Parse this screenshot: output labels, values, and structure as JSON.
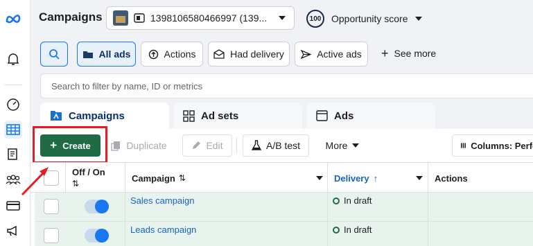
{
  "header": {
    "title": "Campaigns",
    "account_label": "1398106580466997 (139...",
    "opportunity_score": "100",
    "opportunity_label": "Opportunity score"
  },
  "toolbar": {
    "all_ads": "All ads",
    "actions": "Actions",
    "had_delivery": "Had delivery",
    "active_ads": "Active ads",
    "see_more": "See more"
  },
  "search": {
    "placeholder": "Search to filter by name, ID or metrics"
  },
  "tabs": [
    {
      "label": "Campaigns"
    },
    {
      "label": "Ad sets"
    },
    {
      "label": "Ads"
    }
  ],
  "actions": {
    "create": "Create",
    "duplicate": "Duplicate",
    "edit": "Edit",
    "ab_test": "A/B test",
    "more": "More",
    "columns": "Columns: Perfo"
  },
  "table": {
    "columns": {
      "off_on": "Off / On",
      "campaign": "Campaign",
      "delivery": "Delivery",
      "actions": "Actions"
    },
    "rows": [
      {
        "name": "Sales campaign",
        "delivery": "In draft"
      },
      {
        "name": "Leads campaign",
        "delivery": "In draft"
      }
    ]
  },
  "colors": {
    "create_green": "#1e6b45",
    "highlight_red": "#e51c23",
    "link_blue": "#1664c0",
    "active_tab_blue": "#0a3069"
  }
}
